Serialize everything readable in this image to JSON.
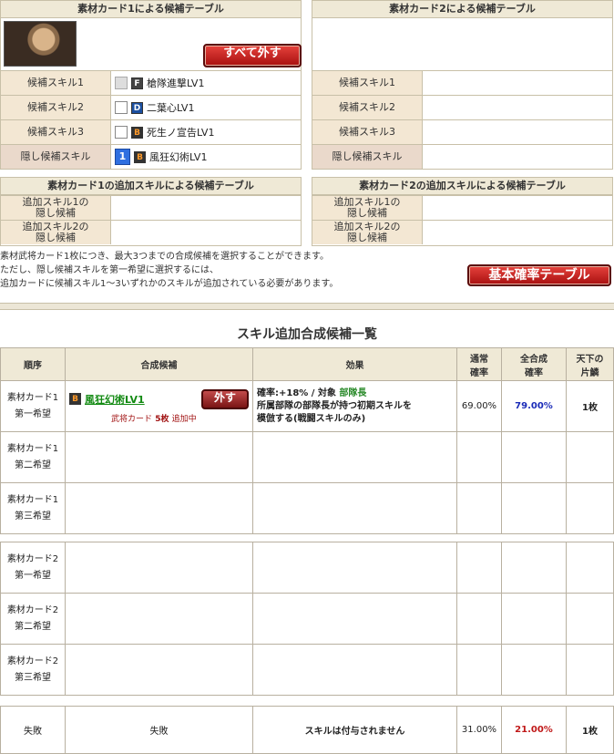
{
  "card1_table": {
    "header": "素材カード1による候補テーブル",
    "remove_all": "すべて外す",
    "rows": [
      {
        "label": "候補スキル1",
        "rank": "F",
        "skill": "槍隊進撃LV1"
      },
      {
        "label": "候補スキル2",
        "rank": "D",
        "skill": "二葉心LV1"
      },
      {
        "label": "候補スキル3",
        "rank": "B",
        "skill": "死生ノ宣告LV1"
      },
      {
        "label": "隠し候補スキル",
        "num": "1",
        "rank": "B",
        "skill": "風狂幻術LV1"
      }
    ]
  },
  "card2_table": {
    "header": "素材カード2による候補テーブル",
    "rows": [
      {
        "label": "候補スキル1"
      },
      {
        "label": "候補スキル2"
      },
      {
        "label": "候補スキル3"
      },
      {
        "label": "隠し候補スキル"
      }
    ]
  },
  "extra1": {
    "header": "素材カード1の追加スキルによる候補テーブル",
    "rows": [
      {
        "l1": "追加スキル1の",
        "l2": "隠し候補"
      },
      {
        "l1": "追加スキル2の",
        "l2": "隠し候補"
      }
    ]
  },
  "extra2": {
    "header": "素材カード2の追加スキルによる候補テーブル",
    "rows": [
      {
        "l1": "追加スキル1の",
        "l2": "隠し候補"
      },
      {
        "l1": "追加スキル2の",
        "l2": "隠し候補"
      }
    ]
  },
  "notes": {
    "line1": "素材武将カード1枚につき、最大3つまでの合成候補を選択することができます。",
    "line2": "ただし、隠し候補スキルを第一希望に選択するには、",
    "line3": "追加カードに候補スキル1〜3いずれかのスキルが追加されている必要があります。",
    "base_rate_button": "基本確率テーブル"
  },
  "list": {
    "title": "スキル追加合成候補一覧",
    "headers": {
      "order": "順序",
      "candidate": "合成候補",
      "effect": "効果",
      "normal_1": "通常",
      "normal_2": "確率",
      "total_1": "全合成",
      "total_2": "確率",
      "tenka_1": "天下の",
      "tenka_2": "片鱗"
    },
    "rows": [
      {
        "o1": "素材カード1",
        "o2": "第一希望",
        "rank": "B",
        "skill": "風狂幻術LV1",
        "remove": "外す",
        "sub_a": "武将カード",
        "sub_b": "5枚",
        "sub_c": "追加中",
        "eff_a": "確率:+18% / 対象",
        "eff_target": "部隊長",
        "eff_b": "所属部隊の部隊長が持つ初期スキルを",
        "eff_c": "模倣する(戦闘スキルのみ)",
        "normal": "69.00%",
        "total": "79.00%",
        "tenka": "1枚"
      },
      {
        "o1": "素材カード1",
        "o2": "第二希望"
      },
      {
        "o1": "素材カード1",
        "o2": "第三希望"
      },
      {
        "o1": "素材カード2",
        "o2": "第一希望"
      },
      {
        "o1": "素材カード2",
        "o2": "第二希望"
      },
      {
        "o1": "素材カード2",
        "o2": "第三希望"
      }
    ],
    "fail": {
      "order": "失敗",
      "candidate": "失敗",
      "effect": "スキルは付与されません",
      "normal": "31.00%",
      "total": "21.00%",
      "tenka": "1枚"
    }
  },
  "colors": {
    "header_bg": "#efe9d6",
    "label_bg": "#f3e7d3",
    "accent_red": "#c01818",
    "accent_blue": "#1a2bb8"
  },
  "icons": {
    "portrait": "general-portrait",
    "check": "checkbox-icon",
    "rank": "rank-badge-icon"
  }
}
